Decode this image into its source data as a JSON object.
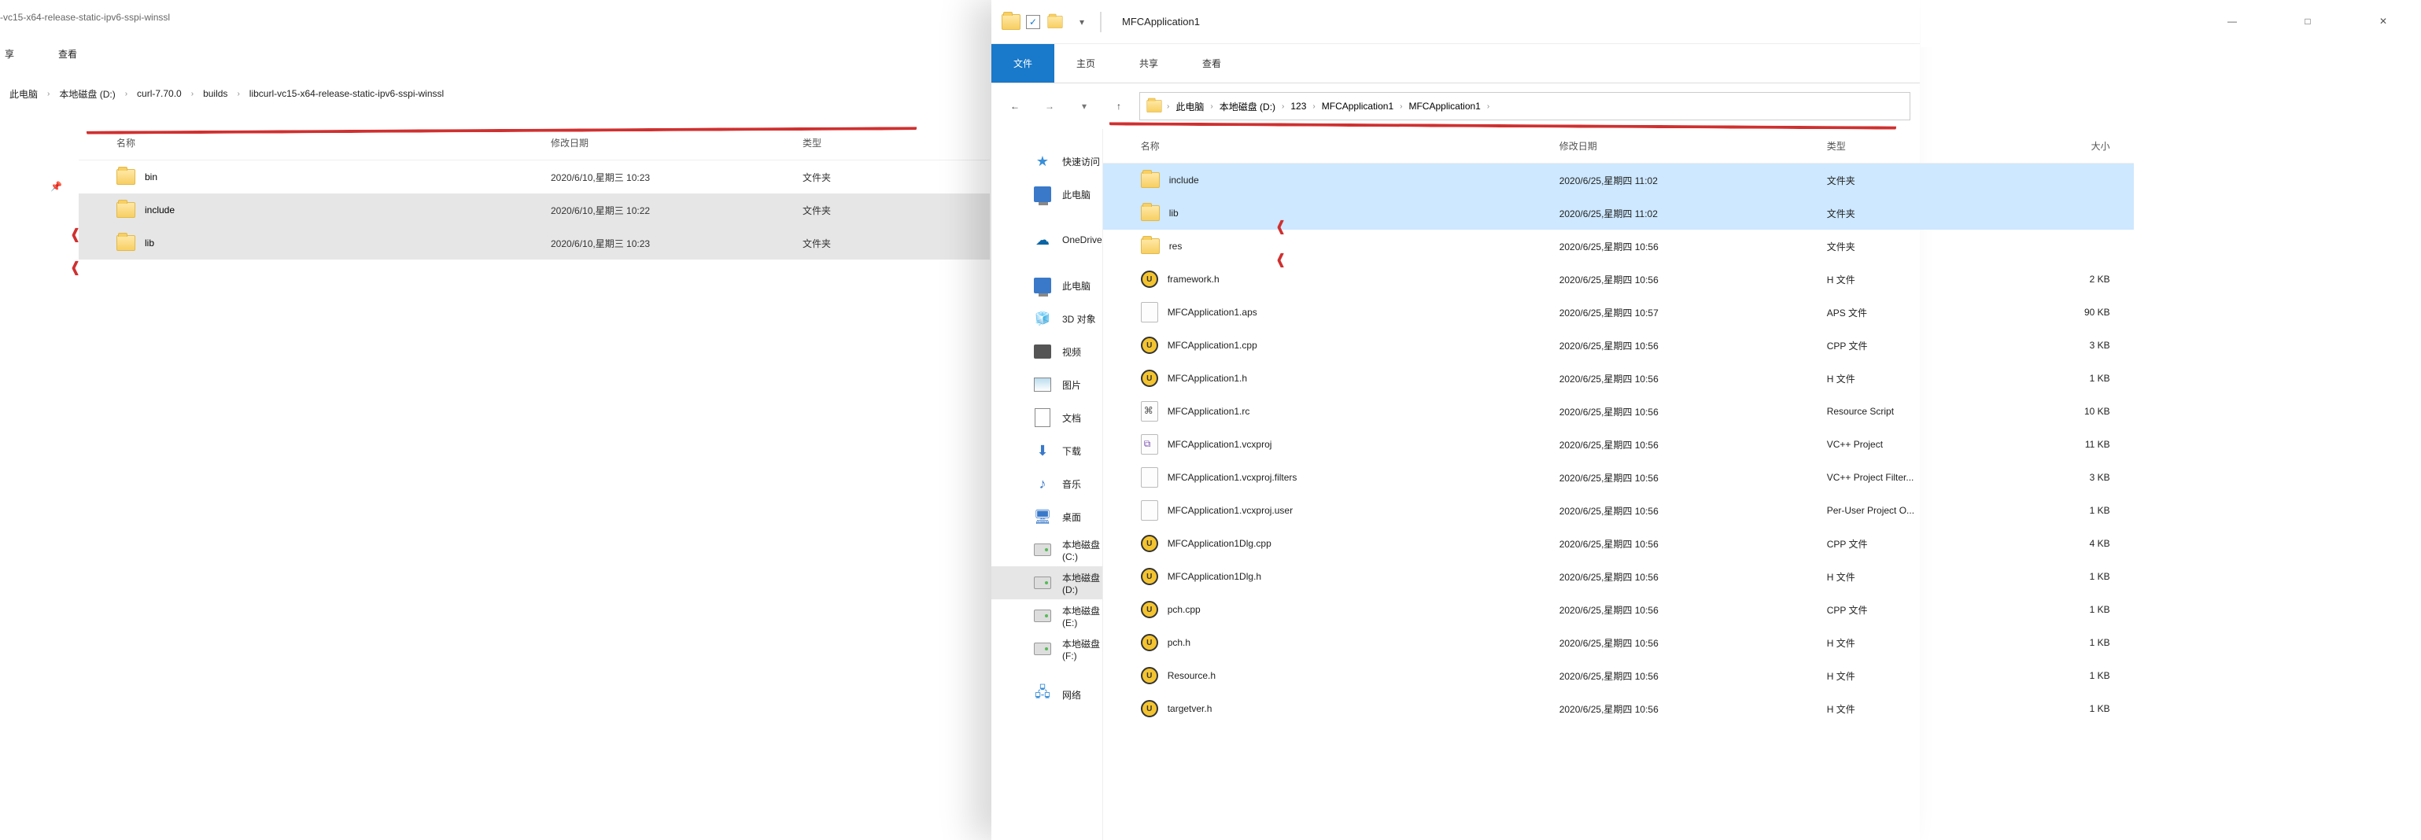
{
  "left_window": {
    "title_fragment": "-vc15-x64-release-static-ipv6-sspi-winssl",
    "ribbon": {
      "share_char": "享",
      "view": "查看"
    },
    "breadcrumbs": [
      "此电脑",
      "本地磁盘 (D:)",
      "curl-7.70.0",
      "builds",
      "libcurl-vc15-x64-release-static-ipv6-sspi-winssl"
    ],
    "columns": {
      "name": "名称",
      "date": "修改日期",
      "type": "类型"
    },
    "rows": [
      {
        "name": "bin",
        "date": "2020/6/10,星期三 10:23",
        "type": "文件夹",
        "selected": false
      },
      {
        "name": "include",
        "date": "2020/6/10,星期三 10:22",
        "type": "文件夹",
        "selected": true
      },
      {
        "name": "lib",
        "date": "2020/6/10,星期三 10:23",
        "type": "文件夹",
        "selected": true
      }
    ],
    "pin_tip": "📌"
  },
  "right_window": {
    "title": "MFCApplication1",
    "ribbon_tabs": {
      "file": "文件",
      "home": "主页",
      "share": "共享",
      "view": "查看"
    },
    "breadcrumbs": [
      "此电脑",
      "本地磁盘 (D:)",
      "123",
      "MFCApplication1",
      "MFCApplication1"
    ],
    "nav_pane": {
      "quick": "快速访问",
      "thispc_top": "此电脑",
      "onedrive": "OneDrive",
      "thispc": "此电脑",
      "objects3d": "3D 对象",
      "videos": "视频",
      "pictures": "图片",
      "documents": "文档",
      "downloads": "下载",
      "music": "音乐",
      "desktop": "桌面",
      "drive_c": "本地磁盘 (C:)",
      "drive_d": "本地磁盘 (D:)",
      "drive_e": "本地磁盘 (E:)",
      "drive_f": "本地磁盘 (F:)",
      "network": "网络"
    },
    "columns": {
      "name": "名称",
      "date": "修改日期",
      "type": "类型",
      "size": "大小"
    },
    "rows": [
      {
        "ico": "folder",
        "name": "include",
        "date": "2020/6/25,星期四 11:02",
        "type": "文件夹",
        "size": "",
        "hi": true
      },
      {
        "ico": "folder",
        "name": "lib",
        "date": "2020/6/25,星期四 11:02",
        "type": "文件夹",
        "size": "",
        "hi": true
      },
      {
        "ico": "folder",
        "name": "res",
        "date": "2020/6/25,星期四 10:56",
        "type": "文件夹",
        "size": ""
      },
      {
        "ico": "ue",
        "name": "framework.h",
        "date": "2020/6/25,星期四 10:56",
        "type": "H 文件",
        "size": "2 KB"
      },
      {
        "ico": "aps",
        "name": "MFCApplication1.aps",
        "date": "2020/6/25,星期四 10:57",
        "type": "APS 文件",
        "size": "90 KB"
      },
      {
        "ico": "ue",
        "name": "MFCApplication1.cpp",
        "date": "2020/6/25,星期四 10:56",
        "type": "CPP 文件",
        "size": "3 KB"
      },
      {
        "ico": "ue",
        "name": "MFCApplication1.h",
        "date": "2020/6/25,星期四 10:56",
        "type": "H 文件",
        "size": "1 KB"
      },
      {
        "ico": "rc",
        "name": "MFCApplication1.rc",
        "date": "2020/6/25,星期四 10:56",
        "type": "Resource Script",
        "size": "10 KB"
      },
      {
        "ico": "vcx",
        "name": "MFCApplication1.vcxproj",
        "date": "2020/6/25,星期四 10:56",
        "type": "VC++ Project",
        "size": "11 KB"
      },
      {
        "ico": "filters",
        "name": "MFCApplication1.vcxproj.filters",
        "date": "2020/6/25,星期四 10:56",
        "type": "VC++ Project Filter...",
        "size": "3 KB"
      },
      {
        "ico": "user",
        "name": "MFCApplication1.vcxproj.user",
        "date": "2020/6/25,星期四 10:56",
        "type": "Per-User Project O...",
        "size": "1 KB"
      },
      {
        "ico": "ue",
        "name": "MFCApplication1Dlg.cpp",
        "date": "2020/6/25,星期四 10:56",
        "type": "CPP 文件",
        "size": "4 KB"
      },
      {
        "ico": "ue",
        "name": "MFCApplication1Dlg.h",
        "date": "2020/6/25,星期四 10:56",
        "type": "H 文件",
        "size": "1 KB"
      },
      {
        "ico": "ue",
        "name": "pch.cpp",
        "date": "2020/6/25,星期四 10:56",
        "type": "CPP 文件",
        "size": "1 KB"
      },
      {
        "ico": "ue",
        "name": "pch.h",
        "date": "2020/6/25,星期四 10:56",
        "type": "H 文件",
        "size": "1 KB"
      },
      {
        "ico": "ue",
        "name": "Resource.h",
        "date": "2020/6/25,星期四 10:56",
        "type": "H 文件",
        "size": "1 KB"
      },
      {
        "ico": "ue",
        "name": "targetver.h",
        "date": "2020/6/25,星期四 10:56",
        "type": "H 文件",
        "size": "1 KB"
      }
    ]
  },
  "win_buttons": {
    "min": "—",
    "max": "□",
    "close": "✕"
  }
}
